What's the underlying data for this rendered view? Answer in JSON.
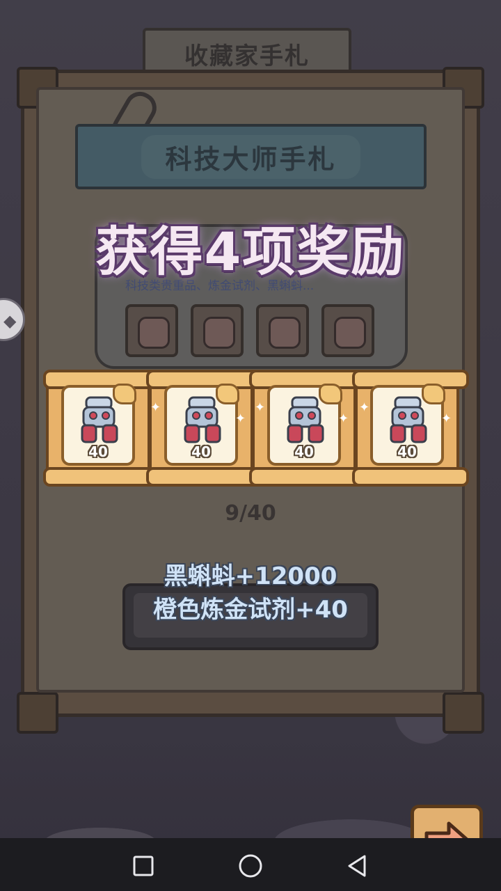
{
  "screen": {
    "title": "收藏家手札",
    "notebook_title": "科技大师手札",
    "panel_description": "科技类贵重品、炼金试剂、黑蝌蚪...",
    "progress": "9/40"
  },
  "overlay": {
    "heading": "获得4项奖励",
    "rewards": [
      {
        "icon": "robot-armor-icon",
        "count": "40"
      },
      {
        "icon": "robot-armor-icon",
        "count": "40"
      },
      {
        "icon": "robot-armor-icon",
        "count": "40"
      },
      {
        "icon": "robot-armor-icon",
        "count": "40"
      }
    ],
    "summary_lines": [
      "黑蝌蚪+12000",
      "橙色炼金试剂+40"
    ]
  },
  "controls": {
    "next_icon": "arrow-right-icon",
    "side_tab_icon": "side-tab-icon"
  },
  "system_nav": {
    "recents_icon": "square-icon",
    "home_icon": "circle-icon",
    "back_icon": "triangle-back-icon"
  },
  "colors": {
    "card_scroll": "#e8b26a",
    "heading_glow": "#c49ad8",
    "summary_text": "#cfe2f6",
    "next_button": "#e2b070"
  }
}
